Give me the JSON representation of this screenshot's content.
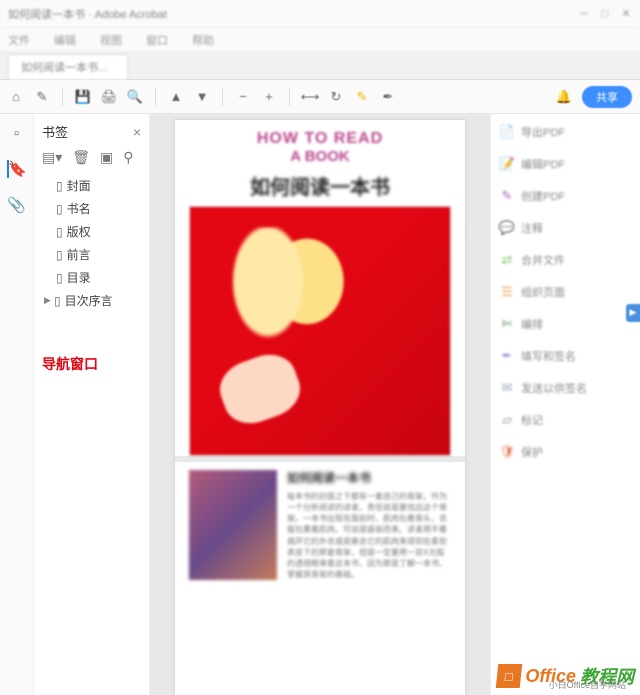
{
  "titlebar": {
    "text": "如何阅读一本书 · Adobe Acrobat"
  },
  "menubar": {
    "items": [
      "文件",
      "编辑",
      "视图",
      "窗口",
      "帮助"
    ]
  },
  "tab": {
    "label": "如何阅读一本书..."
  },
  "toolbar": {
    "share_label": "共享"
  },
  "sidebar": {
    "title": "书签",
    "items": [
      {
        "label": "封面",
        "has_child": false
      },
      {
        "label": "书名",
        "has_child": false
      },
      {
        "label": "版权",
        "has_child": false
      },
      {
        "label": "前言",
        "has_child": false
      },
      {
        "label": "目录",
        "has_child": false
      },
      {
        "label": "目次序言",
        "has_child": true
      }
    ],
    "caption": "导航窗口"
  },
  "cover": {
    "title_en_1": "HOW TO READ",
    "title_en_2": "A BOOK",
    "title_cn": "如何阅读一本书"
  },
  "page2": {
    "heading": "如何阅读一本书",
    "body": "每本书的封面之下都有一套自己的骨架，作为一个分析阅读的读者，责任就是要找出这个骨架。一本书出现在面前时，肌肉包着骨头，衣服包裹着肌肉，可说是盛装而来。读者用不着揭开它的外衣或是撕去它的肌肉来得到在柔软表皮下的那套骨架，但是一定要用一双X光般的透视眼来看这本书，因为那是了解一本书、掌握其骨架的基础。"
  },
  "right_panel": {
    "items": [
      {
        "icon": "📄",
        "color": "#e46ba8",
        "label": "导出PDF"
      },
      {
        "icon": "📝",
        "color": "#6a7be0",
        "label": "编辑PDF"
      },
      {
        "icon": "✎",
        "color": "#b964c9",
        "label": "创建PDF"
      },
      {
        "icon": "💬",
        "color": "#4aa8d8",
        "label": "注释"
      },
      {
        "icon": "⇄",
        "color": "#7bc96f",
        "label": "合并文件"
      },
      {
        "icon": "☰",
        "color": "#f0a050",
        "label": "组织页面"
      },
      {
        "icon": "✄",
        "color": "#5a9c5a",
        "label": "编排"
      },
      {
        "icon": "✒",
        "color": "#a890d8",
        "label": "填写和签名"
      },
      {
        "icon": "✉",
        "color": "#9aacbb",
        "label": "发送以供签名"
      },
      {
        "icon": "▱",
        "color": "#888",
        "label": "标记"
      },
      {
        "icon": "🛡",
        "color": "#e07a50",
        "label": "保护"
      }
    ],
    "tag": "▶"
  },
  "watermark": {
    "brand": "Office",
    "suffix": "教程网",
    "sub": "小白Office自学网站",
    "logo": "□"
  }
}
